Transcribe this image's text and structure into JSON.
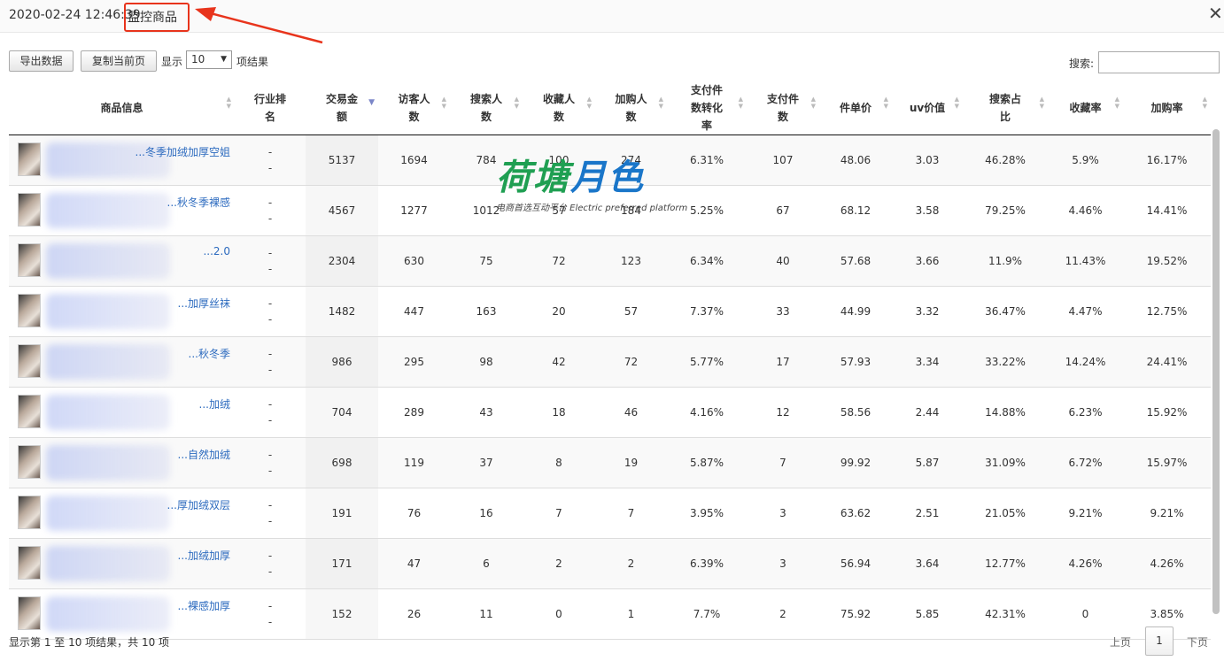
{
  "titlebar": {
    "date": "2020-02-24 12:46:39",
    "label": "监控商品",
    "close": "✕"
  },
  "toolbar": {
    "export_label": "导出数据",
    "copy_label": "复制当前页",
    "show_label": "显示",
    "page_size": "10",
    "suffix_label": "项结果",
    "search_label": "搜索:",
    "search_value": ""
  },
  "table": {
    "headers": [
      {
        "label": "商品信息"
      },
      {
        "label": "行业排名"
      },
      {
        "label": "交易金额"
      },
      {
        "label": "访客人数"
      },
      {
        "label": "搜索人数"
      },
      {
        "label": "收藏人数"
      },
      {
        "label": "加购人数"
      },
      {
        "label": "支付件数转化率"
      },
      {
        "label": "支付件数"
      },
      {
        "label": "件单价"
      },
      {
        "label": "uv价值"
      },
      {
        "label": "搜索占比"
      },
      {
        "label": "收藏率"
      },
      {
        "label": "加购率"
      }
    ],
    "rows": [
      {
        "name": "冬季加绒加厚空姐...",
        "rank1": "-",
        "rank2": "-",
        "amount": "5137",
        "visitors": "1694",
        "searchers": "784",
        "favorites": "100",
        "carts": "274",
        "conv": "6.31%",
        "paid": "107",
        "unit_price": "48.06",
        "uv": "3.03",
        "search_ratio": "46.28%",
        "fav_rate": "5.9%",
        "cart_rate": "16.17%"
      },
      {
        "name": "秋冬季裸感...",
        "rank1": "-",
        "rank2": "-",
        "amount": "4567",
        "visitors": "1277",
        "searchers": "1012",
        "favorites": "57",
        "carts": "184",
        "conv": "5.25%",
        "paid": "67",
        "unit_price": "68.12",
        "uv": "3.58",
        "search_ratio": "79.25%",
        "fav_rate": "4.46%",
        "cart_rate": "14.41%"
      },
      {
        "name": "2.0...",
        "rank1": "-",
        "rank2": "-",
        "amount": "2304",
        "visitors": "630",
        "searchers": "75",
        "favorites": "72",
        "carts": "123",
        "conv": "6.34%",
        "paid": "40",
        "unit_price": "57.68",
        "uv": "3.66",
        "search_ratio": "11.9%",
        "fav_rate": "11.43%",
        "cart_rate": "19.52%"
      },
      {
        "name": "加厚丝袜...",
        "rank1": "-",
        "rank2": "-",
        "amount": "1482",
        "visitors": "447",
        "searchers": "163",
        "favorites": "20",
        "carts": "57",
        "conv": "7.37%",
        "paid": "33",
        "unit_price": "44.99",
        "uv": "3.32",
        "search_ratio": "36.47%",
        "fav_rate": "4.47%",
        "cart_rate": "12.75%"
      },
      {
        "name": "秋冬季...",
        "rank1": "-",
        "rank2": "-",
        "amount": "986",
        "visitors": "295",
        "searchers": "98",
        "favorites": "42",
        "carts": "72",
        "conv": "5.77%",
        "paid": "17",
        "unit_price": "57.93",
        "uv": "3.34",
        "search_ratio": "33.22%",
        "fav_rate": "14.24%",
        "cart_rate": "24.41%"
      },
      {
        "name": "加绒...",
        "rank1": "-",
        "rank2": "-",
        "amount": "704",
        "visitors": "289",
        "searchers": "43",
        "favorites": "18",
        "carts": "46",
        "conv": "4.16%",
        "paid": "12",
        "unit_price": "58.56",
        "uv": "2.44",
        "search_ratio": "14.88%",
        "fav_rate": "6.23%",
        "cart_rate": "15.92%"
      },
      {
        "name": "自然加绒...",
        "rank1": "-",
        "rank2": "-",
        "amount": "698",
        "visitors": "119",
        "searchers": "37",
        "favorites": "8",
        "carts": "19",
        "conv": "5.87%",
        "paid": "7",
        "unit_price": "99.92",
        "uv": "5.87",
        "search_ratio": "31.09%",
        "fav_rate": "6.72%",
        "cart_rate": "15.97%"
      },
      {
        "name": "厚加绒双层...",
        "rank1": "-",
        "rank2": "-",
        "amount": "191",
        "visitors": "76",
        "searchers": "16",
        "favorites": "7",
        "carts": "7",
        "conv": "3.95%",
        "paid": "3",
        "unit_price": "63.62",
        "uv": "2.51",
        "search_ratio": "21.05%",
        "fav_rate": "9.21%",
        "cart_rate": "9.21%"
      },
      {
        "name": "加绒加厚...",
        "rank1": "-",
        "rank2": "-",
        "amount": "171",
        "visitors": "47",
        "searchers": "6",
        "favorites": "2",
        "carts": "2",
        "conv": "6.39%",
        "paid": "3",
        "unit_price": "56.94",
        "uv": "3.64",
        "search_ratio": "12.77%",
        "fav_rate": "4.26%",
        "cart_rate": "4.26%"
      },
      {
        "name": "裸感加厚...",
        "rank1": "-",
        "rank2": "-",
        "amount": "152",
        "visitors": "26",
        "searchers": "11",
        "favorites": "0",
        "carts": "1",
        "conv": "7.7%",
        "paid": "2",
        "unit_price": "75.92",
        "uv": "5.85",
        "search_ratio": "42.31%",
        "fav_rate": "0",
        "cart_rate": "3.85%"
      }
    ]
  },
  "watermark": {
    "title_a": "荷塘",
    "title_b": "月色",
    "subtitle": "电商首选互动平台 Electric preferred platform"
  },
  "footer": {
    "info": "显示第 1 至 10 项结果，共 10 项",
    "prev": "上页",
    "page": "1",
    "next": "下页"
  },
  "colors": {
    "highlight_red": "#e8341c",
    "link_blue": "#2d6bbf",
    "watermark_green": "#1f9f52",
    "watermark_blue": "#1a76c9"
  }
}
